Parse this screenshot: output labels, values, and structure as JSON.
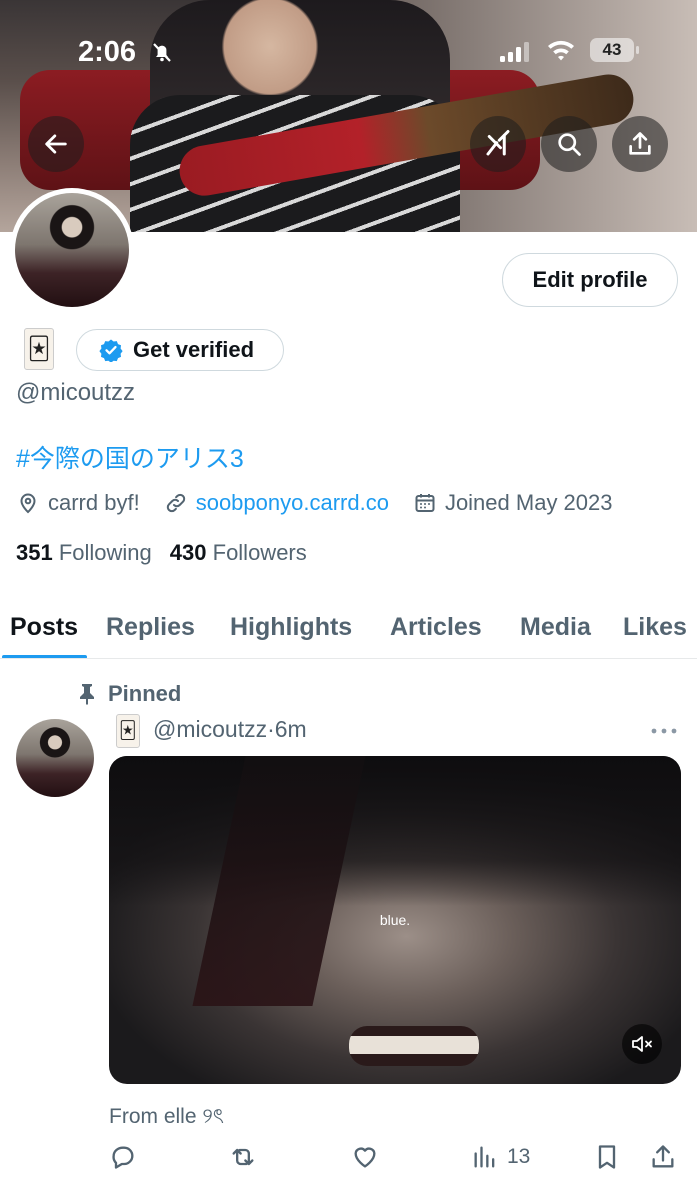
{
  "status_bar": {
    "time": "2:06",
    "battery": "43"
  },
  "profile": {
    "handle": "@micoutzz",
    "bio": "#今際の国のアリス3",
    "location": "carrd byf!",
    "website": "soobponyo.carrd.co",
    "joined": "Joined May 2023",
    "following_count": "351",
    "following_label": "Following",
    "followers_count": "430",
    "followers_label": "Followers"
  },
  "buttons": {
    "edit_profile": "Edit profile",
    "get_verified": "Get verified"
  },
  "tabs": [
    {
      "label": "Posts",
      "active": true
    },
    {
      "label": "Replies"
    },
    {
      "label": "Highlights"
    },
    {
      "label": "Articles"
    },
    {
      "label": "Media"
    },
    {
      "label": "Likes"
    }
  ],
  "pinned_post": {
    "pinned_label": "Pinned",
    "handle": "@micoutzz",
    "separator": "·",
    "time": "6m",
    "video_caption": "blue.",
    "text": "From elle ୨ৎ",
    "views": "13"
  },
  "colors": {
    "accent": "#1d9bf0",
    "text_primary": "#0f1419",
    "text_secondary": "#536471"
  }
}
